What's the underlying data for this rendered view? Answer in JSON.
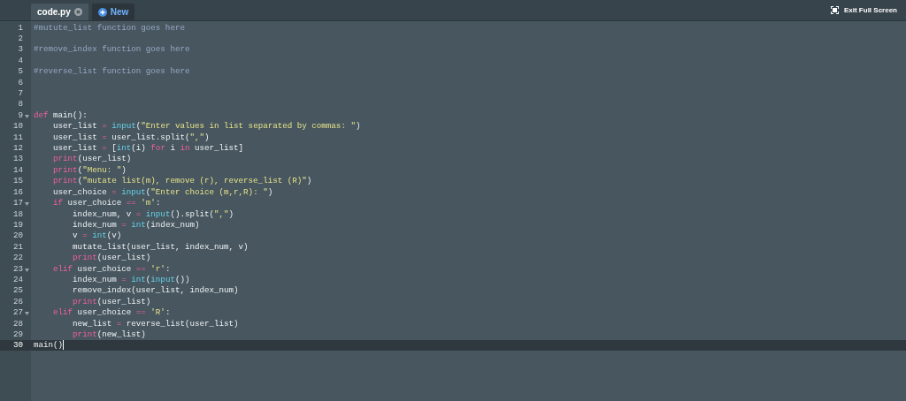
{
  "tabs": [
    {
      "kind": "file",
      "label": "code.py",
      "selected": true
    },
    {
      "kind": "new",
      "label": "New",
      "selected": false
    }
  ],
  "exit_fullscreen": {
    "label": "Exit Full Screen"
  },
  "editor": {
    "lines": [
      {
        "number": "1",
        "active": false,
        "foldable": false,
        "tokens": [
          {
            "kind": "comment",
            "text": "#mutute_list function goes here"
          }
        ]
      },
      {
        "number": "2",
        "active": false,
        "foldable": false
      },
      {
        "number": "3",
        "active": false,
        "foldable": false,
        "tokens": [
          {
            "kind": "comment",
            "text": "#remove_index function goes here"
          }
        ]
      },
      {
        "number": "4",
        "active": false,
        "foldable": false
      },
      {
        "number": "5",
        "active": false,
        "foldable": false,
        "tokens": [
          {
            "kind": "comment",
            "text": "#reverse_list function goes here"
          }
        ]
      },
      {
        "number": "6",
        "active": false,
        "foldable": false
      },
      {
        "number": "7",
        "active": false,
        "foldable": false
      },
      {
        "number": "8",
        "active": false,
        "foldable": false
      },
      {
        "number": "9",
        "active": false,
        "foldable": true,
        "tokens": [
          {
            "kind": "keyword",
            "text": "def"
          },
          {
            "kind": "plain",
            "text": " main():"
          }
        ]
      },
      {
        "number": "10",
        "active": false,
        "foldable": false,
        "tokens": [
          {
            "kind": "plain",
            "text": "    user_list "
          },
          {
            "kind": "op",
            "text": "= "
          },
          {
            "kind": "builtin",
            "text": "input"
          },
          {
            "kind": "plain",
            "text": "("
          },
          {
            "kind": "string",
            "text": "\"Enter values in list separated by commas: \""
          },
          {
            "kind": "plain",
            "text": ")"
          }
        ]
      },
      {
        "number": "11",
        "active": false,
        "foldable": false,
        "tokens": [
          {
            "kind": "plain",
            "text": "    user_list "
          },
          {
            "kind": "op",
            "text": "="
          },
          {
            "kind": "plain",
            "text": " user_list.split("
          },
          {
            "kind": "string",
            "text": "\",\""
          },
          {
            "kind": "plain",
            "text": ")"
          }
        ]
      },
      {
        "number": "12",
        "active": false,
        "foldable": false,
        "tokens": [
          {
            "kind": "plain",
            "text": "    user_list "
          },
          {
            "kind": "op",
            "text": "="
          },
          {
            "kind": "plain",
            "text": " ["
          },
          {
            "kind": "builtin",
            "text": "int"
          },
          {
            "kind": "plain",
            "text": "(i) "
          },
          {
            "kind": "keyword",
            "text": "for"
          },
          {
            "kind": "plain",
            "text": " i "
          },
          {
            "kind": "keyword",
            "text": "in"
          },
          {
            "kind": "plain",
            "text": " user_list]"
          }
        ]
      },
      {
        "number": "13",
        "active": false,
        "foldable": false,
        "tokens": [
          {
            "kind": "keyword",
            "text": "    print"
          },
          {
            "kind": "plain",
            "text": "(user_list)"
          }
        ]
      },
      {
        "number": "14",
        "active": false,
        "foldable": false,
        "tokens": [
          {
            "kind": "keyword",
            "text": "    print"
          },
          {
            "kind": "plain",
            "text": "("
          },
          {
            "kind": "string",
            "text": "\"Menu: \""
          },
          {
            "kind": "plain",
            "text": ")"
          }
        ]
      },
      {
        "number": "15",
        "active": false,
        "foldable": false,
        "tokens": [
          {
            "kind": "keyword",
            "text": "    print"
          },
          {
            "kind": "plain",
            "text": "("
          },
          {
            "kind": "string",
            "text": "\"mutate list(m), remove (r), reverse_list (R)\""
          },
          {
            "kind": "plain",
            "text": ")"
          }
        ]
      },
      {
        "number": "16",
        "active": false,
        "foldable": false,
        "tokens": [
          {
            "kind": "plain",
            "text": "    user_choice "
          },
          {
            "kind": "op",
            "text": "= "
          },
          {
            "kind": "builtin",
            "text": "input"
          },
          {
            "kind": "plain",
            "text": "("
          },
          {
            "kind": "string",
            "text": "\"Enter choice (m,r,R): \""
          },
          {
            "kind": "plain",
            "text": ")"
          }
        ]
      },
      {
        "number": "17",
        "active": false,
        "foldable": true,
        "tokens": [
          {
            "kind": "keyword",
            "text": "    if"
          },
          {
            "kind": "plain",
            "text": " user_choice "
          },
          {
            "kind": "op",
            "text": "== "
          },
          {
            "kind": "string",
            "text": "'m'"
          },
          {
            "kind": "plain",
            "text": ":"
          }
        ]
      },
      {
        "number": "18",
        "active": false,
        "foldable": false,
        "tokens": [
          {
            "kind": "plain",
            "text": "        index_num, v "
          },
          {
            "kind": "op",
            "text": "= "
          },
          {
            "kind": "builtin",
            "text": "input"
          },
          {
            "kind": "plain",
            "text": "().split("
          },
          {
            "kind": "string",
            "text": "\",\""
          },
          {
            "kind": "plain",
            "text": ")"
          }
        ]
      },
      {
        "number": "19",
        "active": false,
        "foldable": false,
        "tokens": [
          {
            "kind": "plain",
            "text": "        index_num "
          },
          {
            "kind": "op",
            "text": "= "
          },
          {
            "kind": "builtin",
            "text": "int"
          },
          {
            "kind": "plain",
            "text": "(index_num)"
          }
        ]
      },
      {
        "number": "20",
        "active": false,
        "foldable": false,
        "tokens": [
          {
            "kind": "plain",
            "text": "        v "
          },
          {
            "kind": "op",
            "text": "= "
          },
          {
            "kind": "builtin",
            "text": "int"
          },
          {
            "kind": "plain",
            "text": "(v)"
          }
        ]
      },
      {
        "number": "21",
        "active": false,
        "foldable": false,
        "tokens": [
          {
            "kind": "plain",
            "text": "        mutate_list(user_list, index_num, v)"
          }
        ]
      },
      {
        "number": "22",
        "active": false,
        "foldable": false,
        "tokens": [
          {
            "kind": "keyword",
            "text": "        print"
          },
          {
            "kind": "plain",
            "text": "(user_list)"
          }
        ]
      },
      {
        "number": "23",
        "active": false,
        "foldable": true,
        "tokens": [
          {
            "kind": "keyword",
            "text": "    elif"
          },
          {
            "kind": "plain",
            "text": " user_choice "
          },
          {
            "kind": "op",
            "text": "== "
          },
          {
            "kind": "string",
            "text": "'r'"
          },
          {
            "kind": "plain",
            "text": ":"
          }
        ]
      },
      {
        "number": "24",
        "active": false,
        "foldable": false,
        "tokens": [
          {
            "kind": "plain",
            "text": "        index_num "
          },
          {
            "kind": "op",
            "text": "= "
          },
          {
            "kind": "builtin",
            "text": "int"
          },
          {
            "kind": "plain",
            "text": "("
          },
          {
            "kind": "builtin",
            "text": "input"
          },
          {
            "kind": "plain",
            "text": "())"
          }
        ]
      },
      {
        "number": "25",
        "active": false,
        "foldable": false,
        "tokens": [
          {
            "kind": "plain",
            "text": "        remove_index(user_list, index_num)"
          }
        ]
      },
      {
        "number": "26",
        "active": false,
        "foldable": false,
        "tokens": [
          {
            "kind": "keyword",
            "text": "        print"
          },
          {
            "kind": "plain",
            "text": "(user_list)"
          }
        ]
      },
      {
        "number": "27",
        "active": false,
        "foldable": true,
        "tokens": [
          {
            "kind": "keyword",
            "text": "    elif"
          },
          {
            "kind": "plain",
            "text": " user_choice "
          },
          {
            "kind": "op",
            "text": "== "
          },
          {
            "kind": "string",
            "text": "'R'"
          },
          {
            "kind": "plain",
            "text": ":"
          }
        ]
      },
      {
        "number": "28",
        "active": false,
        "foldable": false,
        "tokens": [
          {
            "kind": "plain",
            "text": "        new_list "
          },
          {
            "kind": "op",
            "text": "="
          },
          {
            "kind": "plain",
            "text": " reverse_list(user_list)"
          }
        ]
      },
      {
        "number": "29",
        "active": false,
        "foldable": false,
        "tokens": [
          {
            "kind": "keyword",
            "text": "        print"
          },
          {
            "kind": "plain",
            "text": "(new_list)"
          }
        ]
      },
      {
        "number": "30",
        "active": true,
        "foldable": false,
        "tokens": [
          {
            "kind": "plain",
            "text": "main()"
          }
        ]
      }
    ]
  }
}
